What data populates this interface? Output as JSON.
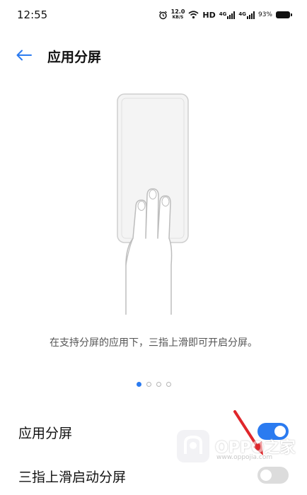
{
  "status_bar": {
    "time": "12:55",
    "speed_value": "12.0",
    "speed_unit": "KB/S",
    "hd_label": "HD",
    "net1": "4G",
    "net2": "4G",
    "battery": "93%"
  },
  "header": {
    "title": "应用分屏"
  },
  "tutorial": {
    "caption": "在支持分屏的应用下，三指上滑即可开启分屏。",
    "page_count": 4,
    "active_page": 1
  },
  "settings": [
    {
      "label": "应用分屏",
      "enabled": true
    },
    {
      "label": "三指上滑启动分屏",
      "enabled": false
    }
  ],
  "watermark": {
    "text": "OPPO之家",
    "url": "www.oppojia.com"
  },
  "colors": {
    "accent": "#2b7bf0",
    "annotation_arrow": "#e0262b"
  }
}
